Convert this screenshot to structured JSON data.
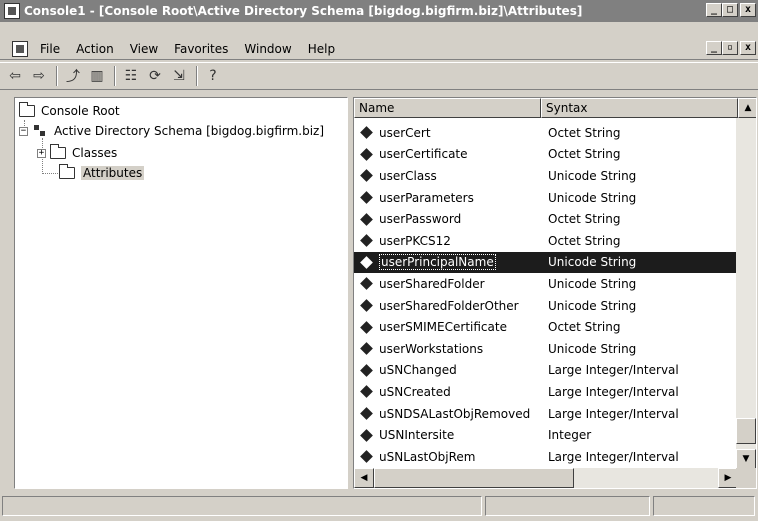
{
  "window": {
    "title": "Console1 - [Console Root\\Active Directory Schema [bigdog.bigfirm.biz]\\Attributes]",
    "minimize": "_",
    "maximize": "□",
    "close": "x",
    "child_minimize": "_",
    "child_restore": "▫",
    "child_close": "x"
  },
  "menu": [
    "File",
    "Action",
    "View",
    "Favorites",
    "Window",
    "Help"
  ],
  "toolbar": {
    "icons": [
      "back-arrow-icon",
      "forward-arrow-icon",
      "up-one-level-icon",
      "show-hide-tree-icon",
      "properties-icon",
      "refresh-icon",
      "export-list-icon",
      "help-icon"
    ],
    "glyphs": {
      "back": "⇦",
      "forward": "⇨",
      "up": "⤴",
      "tree": "▥",
      "props": "☷",
      "refresh": "⟳",
      "export": "⇲",
      "help": "?"
    }
  },
  "tree": {
    "root": "Console Root",
    "schema": "Active Directory Schema [bigdog.bigfirm.biz]",
    "classes": "Classes",
    "attributes": "Attributes",
    "expander_minus": "−",
    "expander_plus": "+"
  },
  "list": {
    "columns": {
      "name": "Name",
      "syntax": "Syntax"
    },
    "rows": [
      {
        "name": "userCert",
        "syntax": "Octet String"
      },
      {
        "name": "userCertificate",
        "syntax": "Octet String"
      },
      {
        "name": "userClass",
        "syntax": "Unicode String"
      },
      {
        "name": "userParameters",
        "syntax": "Unicode String"
      },
      {
        "name": "userPassword",
        "syntax": "Octet String"
      },
      {
        "name": "userPKCS12",
        "syntax": "Octet String"
      },
      {
        "name": "userPrincipalName",
        "syntax": "Unicode String",
        "selected": true
      },
      {
        "name": "userSharedFolder",
        "syntax": "Unicode String"
      },
      {
        "name": "userSharedFolderOther",
        "syntax": "Unicode String"
      },
      {
        "name": "userSMIMECertificate",
        "syntax": "Octet String"
      },
      {
        "name": "userWorkstations",
        "syntax": "Unicode String"
      },
      {
        "name": "uSNChanged",
        "syntax": "Large Integer/Interval"
      },
      {
        "name": "uSNCreated",
        "syntax": "Large Integer/Interval"
      },
      {
        "name": "uSNDSALastObjRemoved",
        "syntax": "Large Integer/Interval"
      },
      {
        "name": "USNIntersite",
        "syntax": "Integer"
      },
      {
        "name": "uSNLastObjRem",
        "syntax": "Large Integer/Interval"
      }
    ]
  },
  "scroll": {
    "up": "▲",
    "down": "▼",
    "left": "◀",
    "right": "▶"
  }
}
